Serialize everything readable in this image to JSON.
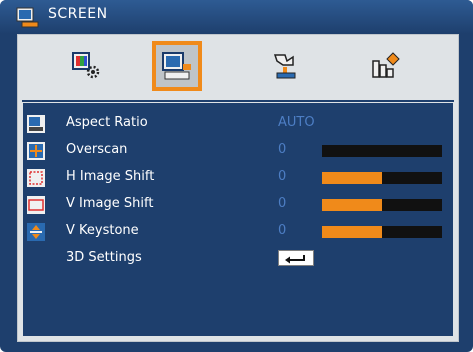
{
  "title": "SCREEN",
  "tabs": [
    {
      "icon": "image-settings-icon",
      "active": false
    },
    {
      "icon": "screen-icon",
      "active": true
    },
    {
      "icon": "setup-icon",
      "active": false
    },
    {
      "icon": "options-icon",
      "active": false
    }
  ],
  "rows": [
    {
      "label": "Aspect Ratio",
      "value": "AUTO",
      "icon": "aspect-ratio-icon",
      "control": "text"
    },
    {
      "label": "Overscan",
      "value": "0",
      "icon": "overscan-icon",
      "control": "slider",
      "level": 0.0
    },
    {
      "label": "H Image Shift",
      "value": "0",
      "icon": "h-image-shift-icon",
      "control": "slider",
      "level": 0.5
    },
    {
      "label": "V Image Shift",
      "value": "0",
      "icon": "v-image-shift-icon",
      "control": "slider",
      "level": 0.5
    },
    {
      "label": "V Keystone",
      "value": "0",
      "icon": "v-keystone-icon",
      "control": "slider",
      "level": 0.5
    },
    {
      "label": "3D Settings",
      "value": "",
      "icon": "",
      "control": "enter"
    }
  ],
  "colors": {
    "accent": "#f08a1a",
    "background": "#1e3f6d",
    "value_text": "#4d7ec4"
  }
}
